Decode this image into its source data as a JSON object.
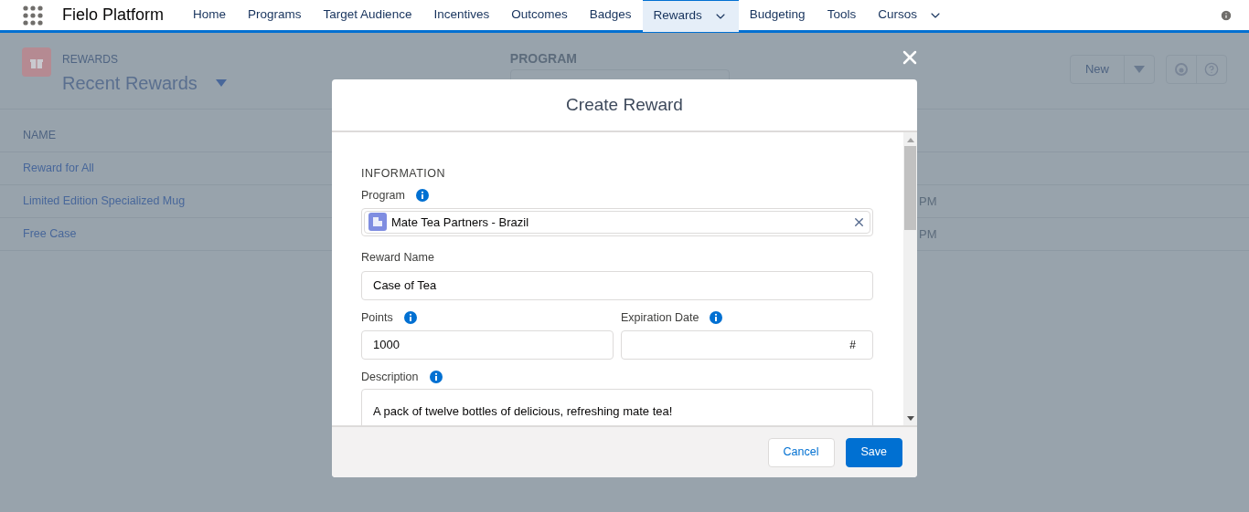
{
  "app": {
    "name": "Fielo Platform"
  },
  "nav": [
    {
      "label": "Home",
      "selected": false,
      "has_menu": false
    },
    {
      "label": "Programs",
      "selected": false,
      "has_menu": false
    },
    {
      "label": "Target Audience",
      "selected": false,
      "has_menu": false
    },
    {
      "label": "Incentives",
      "selected": false,
      "has_menu": false
    },
    {
      "label": "Outcomes",
      "selected": false,
      "has_menu": false
    },
    {
      "label": "Badges",
      "selected": false,
      "has_menu": false
    },
    {
      "label": "Rewards",
      "selected": true,
      "has_menu": true
    },
    {
      "label": "Budgeting",
      "selected": false,
      "has_menu": false
    },
    {
      "label": "Tools",
      "selected": false,
      "has_menu": false
    },
    {
      "label": "Cursos",
      "selected": false,
      "has_menu": true
    }
  ],
  "page": {
    "object_label": "REWARDS",
    "list_view": "Recent Rewards",
    "program_label": "PROGRAM",
    "new_button": "New",
    "table": {
      "columns": [
        "NAME"
      ],
      "rows": [
        {
          "name": "Reward for All"
        },
        {
          "name": "Limited Edition Specialized Mug",
          "column_2": "PM"
        },
        {
          "name": "Free Case",
          "column_2": "PM"
        }
      ]
    }
  },
  "modal": {
    "title": "Create Reward",
    "section": "INFORMATION",
    "program_field": {
      "label": "Program",
      "value": "Mate Tea Partners - Brazil"
    },
    "reward_name": {
      "label": "Reward Name",
      "value": "Case of Tea"
    },
    "points": {
      "label": "Points",
      "value": "1000"
    },
    "expiration_date": {
      "label": "Expiration Date",
      "icon_text": "#"
    },
    "description": {
      "label": "Description",
      "value": "A pack of twelve bottles of delicious, refreshing mate tea!"
    },
    "buttons": [
      {
        "label": "Cancel",
        "kind": "neutral"
      },
      {
        "label": "Save",
        "kind": "brand"
      }
    ]
  }
}
